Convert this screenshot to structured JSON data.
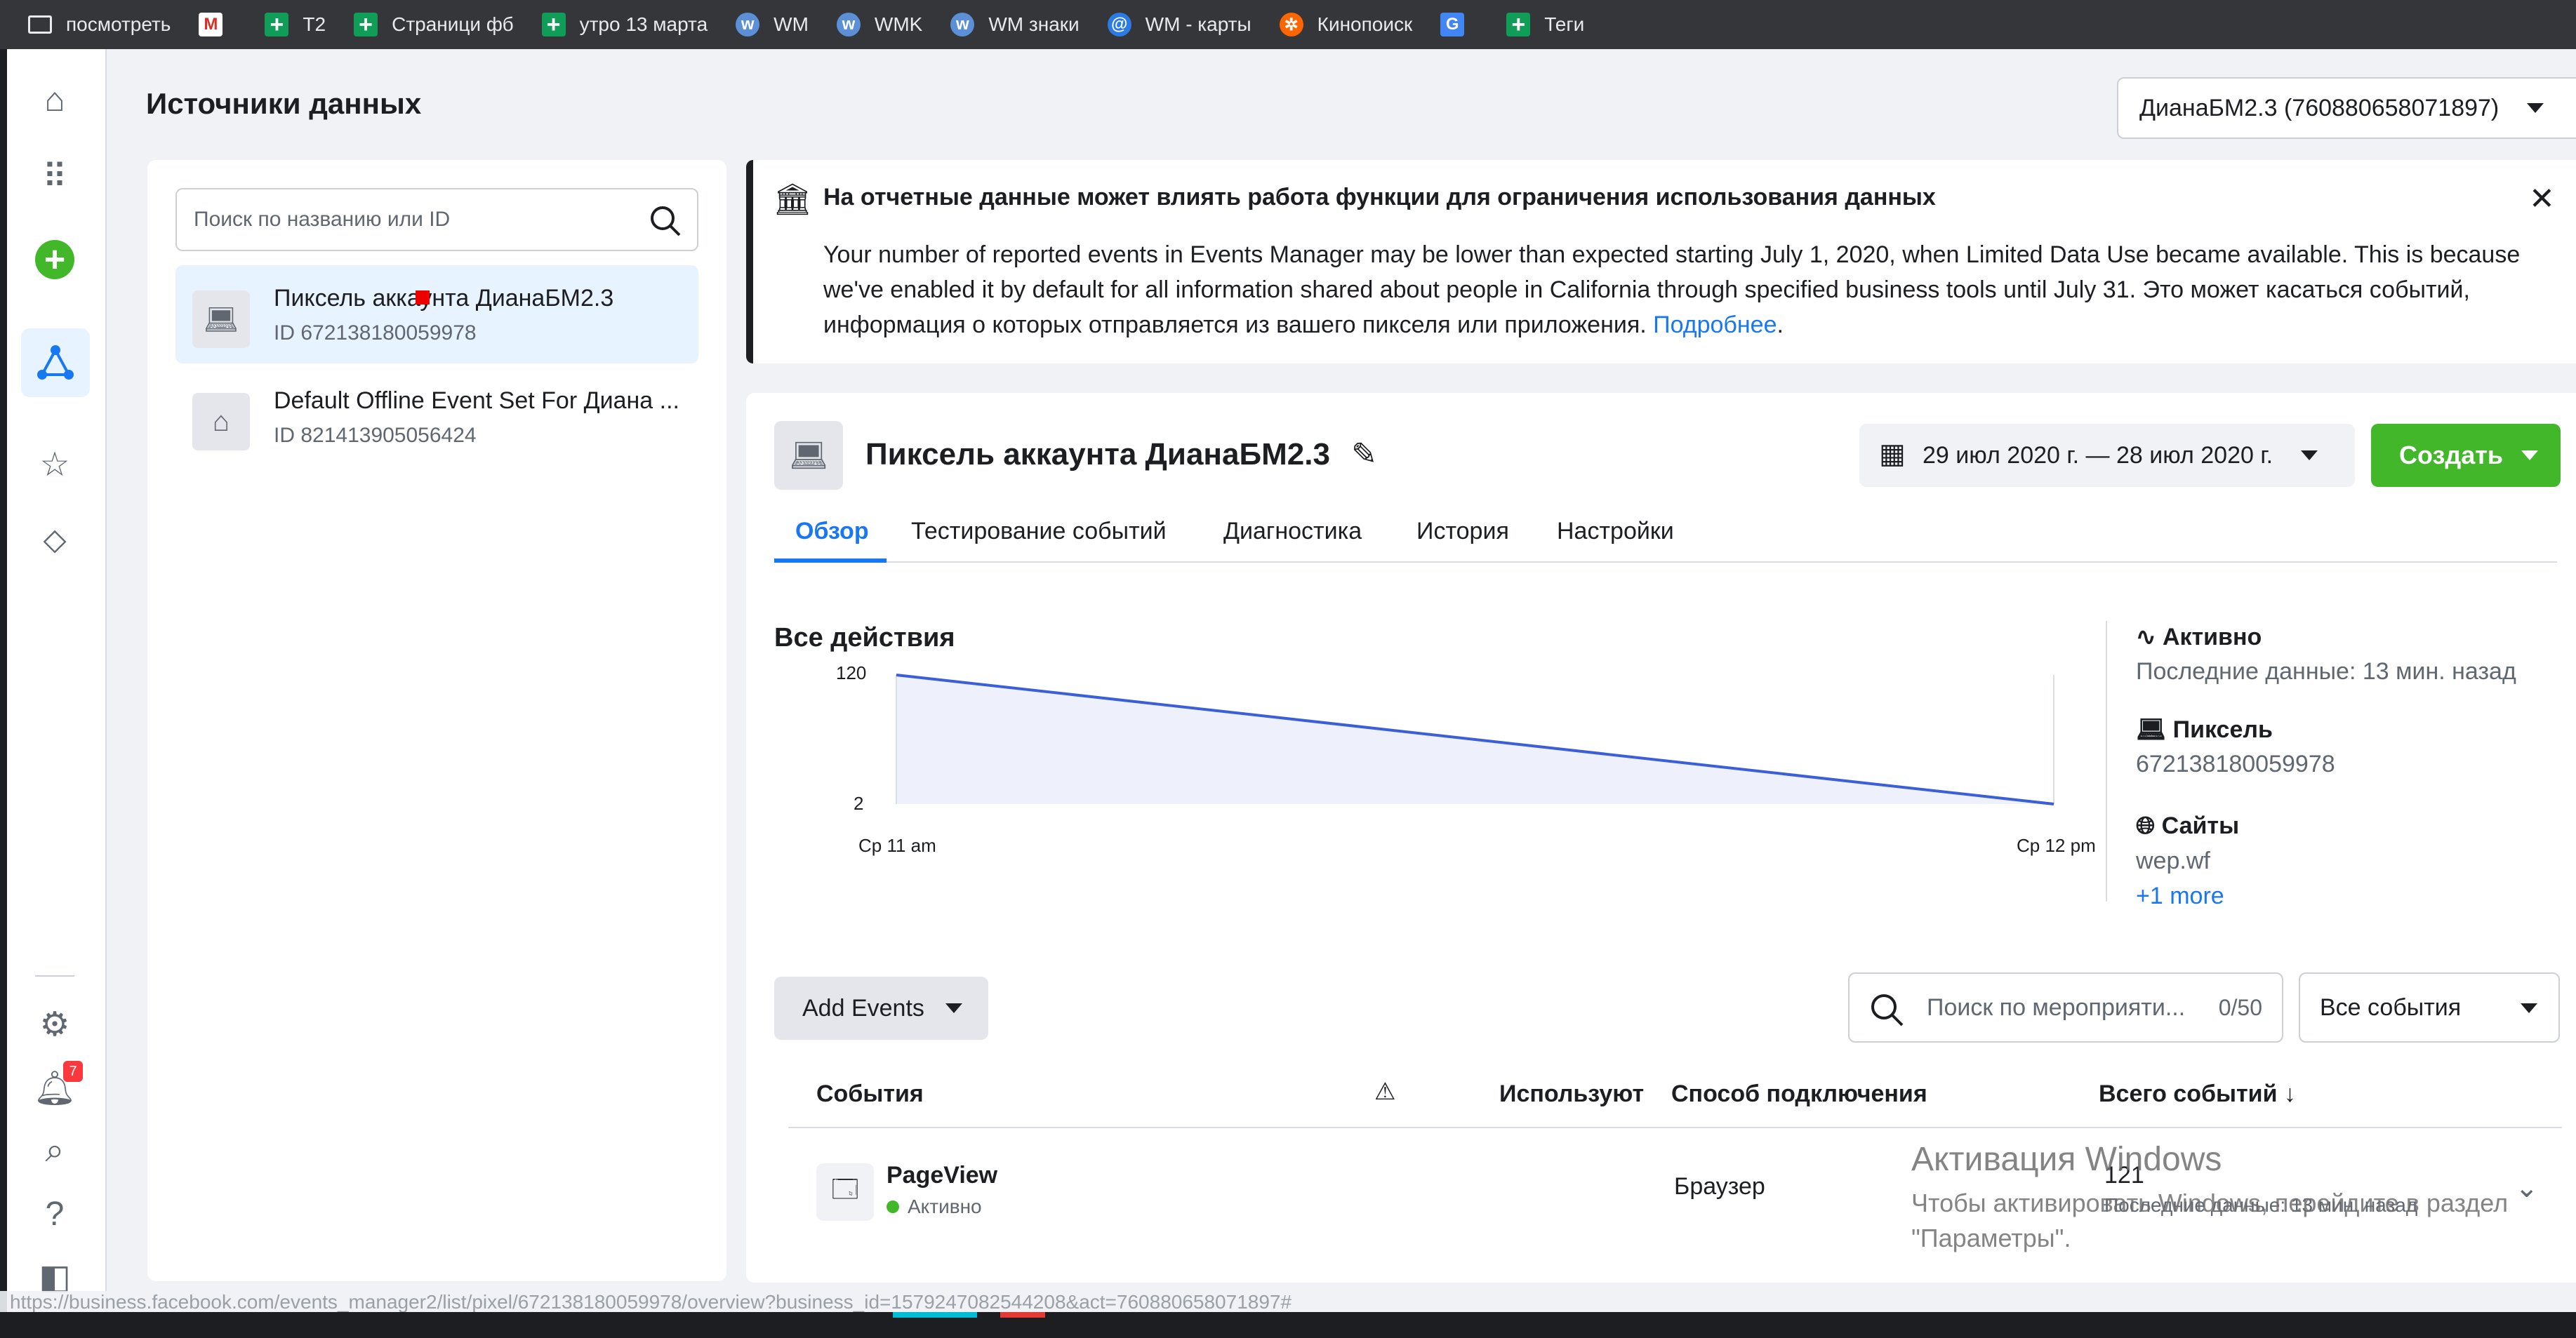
{
  "bookmarks": [
    {
      "label": "посмотреть",
      "icon": "folder-icon"
    },
    {
      "label": "",
      "icon": "gmail-icon"
    },
    {
      "label": "Т2",
      "icon": "sheets-icon"
    },
    {
      "label": "Страници фб",
      "icon": "sheets-icon"
    },
    {
      "label": "утро 13 марта",
      "icon": "sheets-icon"
    },
    {
      "label": "WM",
      "icon": "webmoney-icon"
    },
    {
      "label": "WMK",
      "icon": "webmoney-icon"
    },
    {
      "label": "WM знаки",
      "icon": "webmoney-icon"
    },
    {
      "label": "WM - карты",
      "icon": "at-icon"
    },
    {
      "label": "Кинопоиск",
      "icon": "kinopoisk-icon"
    },
    {
      "label": "",
      "icon": "translate-icon"
    },
    {
      "label": "Теги",
      "icon": "sheets-icon"
    }
  ],
  "rail": {
    "notification_count": "7"
  },
  "header": {
    "title": "Источники данных",
    "account": "ДианаБМ2.3 (760880658071897)"
  },
  "sources": {
    "search_placeholder": "Поиск по названию или ID",
    "items": [
      {
        "name": "Пиксель аккаунта ДианаБМ2.3",
        "id": "ID 672138180059978"
      },
      {
        "name": "Default Offline Event Set For Диана ...",
        "id": "ID 821413905056424"
      }
    ]
  },
  "notice": {
    "title": "На отчетные данные может влиять работа функции для ограничения использования данных",
    "body": "Your number of reported events in Events Manager may be lower than expected starting July 1, 2020, when Limited Data Use became available. This is because we've enabled it by default for all information shared about people in California through specified business tools until July 31. Это может касаться событий, информация о которых отправляется из вашего пикселя или приложения.",
    "link": "Подробнее"
  },
  "pixel": {
    "title": "Пиксель аккаунта ДианаБМ2.3",
    "date_range": "29 июл 2020 г. — 28 июл 2020 г.",
    "create_label": "Создать",
    "tabs": [
      "Обзор",
      "Тестирование событий",
      "Диагностика",
      "История",
      "Настройки"
    ]
  },
  "chart_data": {
    "type": "area",
    "title": "Все действия",
    "x": [
      "Ср 11 am",
      "Ср 12 pm"
    ],
    "series": [
      {
        "values": [
          120,
          2
        ]
      }
    ],
    "yticks": [
      "120",
      "2"
    ],
    "ylim": [
      2,
      120
    ],
    "grid": false,
    "colors": {
      "line": "#3b5fd9",
      "fill": "#eef1fb"
    }
  },
  "info": {
    "status_label": "Активно",
    "status_sub": "Последние данные: 13 мин. назад",
    "pixel_label": "Пиксель",
    "pixel_id": "672138180059978",
    "sites_label": "Сайты",
    "site": "wep.wf",
    "more": "+1 more"
  },
  "events_toolbar": {
    "add_events": "Add Events",
    "search_placeholder": "Поиск по мероприяти...",
    "search_count": "0/50",
    "filter": "Все события"
  },
  "table": {
    "headers": [
      "События",
      "Используют",
      "Способ подключения",
      "Всего событий"
    ],
    "rows": [
      {
        "name": "PageView",
        "status": "Активно",
        "connection": "Браузер",
        "total": "121",
        "last": "Последние данные: 13 мин. назад"
      }
    ]
  },
  "windows_watermark": {
    "title": "Активация Windows",
    "sub": "Чтобы активировать Windows, перейдите в раздел \"Параметры\"."
  },
  "status_url": "https://business.facebook.com/events_manager2/list/pixel/672138180059978/overview?business_id=1579247082544208&act=760880658071897#"
}
